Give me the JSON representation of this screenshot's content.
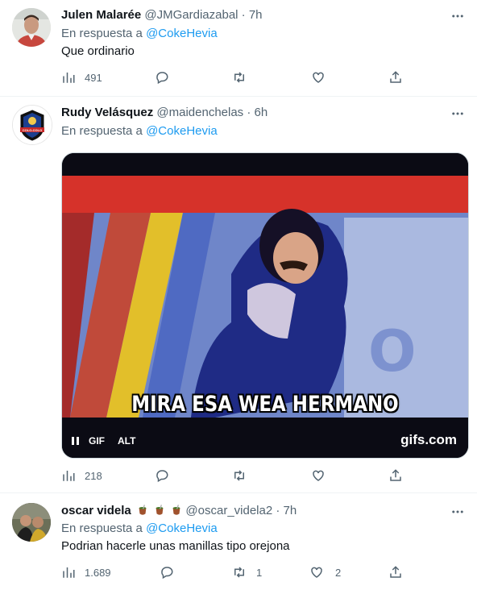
{
  "tweets": [
    {
      "name": "Julen Malarée",
      "handle": "@JMGardiazabal",
      "dot": "·",
      "time": "7h",
      "reply_prefix": "En respuesta a",
      "reply_mention": "@CokeHevia",
      "text": "Que ordinario",
      "views": "491",
      "replies": "",
      "retweets": "",
      "likes": ""
    },
    {
      "name": "Rudy Velásquez",
      "handle": "@maidenchelas",
      "dot": "·",
      "time": "6h",
      "reply_prefix": "En respuesta a",
      "reply_mention": "@CokeHevia",
      "media": {
        "caption": "MIRA ESA WEA HERMANO",
        "gif_label": "GIF",
        "alt_label": "ALT",
        "credit": "gifs.com",
        "logo_text": "COLO-COLO"
      },
      "views": "218",
      "replies": "",
      "retweets": "",
      "likes": ""
    },
    {
      "name": "oscar videla",
      "handle": "@oscar_videla2",
      "dot": "·",
      "time": "7h",
      "reply_prefix": "En respuesta a",
      "reply_mention": "@CokeHevia",
      "text": "Podrian hacerle unas manillas tipo orejona",
      "views": "1.689",
      "replies": "",
      "retweets": "1",
      "likes": "2"
    }
  ],
  "icons": [
    "more-icon",
    "views-icon",
    "reply-icon",
    "retweet-icon",
    "like-icon",
    "share-icon",
    "pause-icon",
    "mate-emoji-icon"
  ],
  "colors": {
    "accent": "#1d9bf0",
    "muted": "#536471",
    "text": "#0f1419"
  }
}
